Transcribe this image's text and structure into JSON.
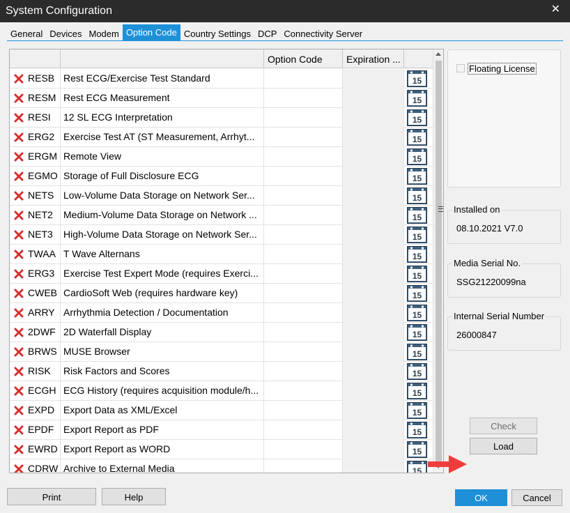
{
  "window": {
    "title": "System Configuration"
  },
  "tabs": [
    {
      "label": "General",
      "active": false
    },
    {
      "label": "Devices",
      "active": false
    },
    {
      "label": "Modem",
      "active": false
    },
    {
      "label": "Option Code",
      "active": true
    },
    {
      "label": "Country Settings",
      "active": false
    },
    {
      "label": "DCP",
      "active": false
    },
    {
      "label": "Connectivity Server",
      "active": false
    }
  ],
  "grid": {
    "headers": {
      "col1": "",
      "col2": "",
      "option_code": "Option Code",
      "expiration": "Expiration ...",
      "col5": ""
    },
    "calendar_label": "15",
    "rows": [
      {
        "code": "RESB",
        "description": "Rest ECG/Exercise Test Standard"
      },
      {
        "code": "RESM",
        "description": "Rest ECG Measurement"
      },
      {
        "code": "RESI",
        "description": "12 SL ECG Interpretation"
      },
      {
        "code": "ERG2",
        "description": "Exercise Test AT (ST Measurement, Arrhyt..."
      },
      {
        "code": "ERGM",
        "description": "Remote View"
      },
      {
        "code": "EGMO",
        "description": "Storage of Full Disclosure ECG"
      },
      {
        "code": "NETS",
        "description": "Low-Volume Data Storage on Network Ser..."
      },
      {
        "code": "NET2",
        "description": "Medium-Volume Data Storage on Network ..."
      },
      {
        "code": "NET3",
        "description": "High-Volume Data Storage on Network Ser..."
      },
      {
        "code": "TWAA",
        "description": "T Wave Alternans"
      },
      {
        "code": "ERG3",
        "description": "Exercise Test Expert Mode (requires Exerci..."
      },
      {
        "code": "CWEB",
        "description": "CardioSoft Web (requires hardware key)"
      },
      {
        "code": "ARRY",
        "description": "Arrhythmia Detection / Documentation"
      },
      {
        "code": "2DWF",
        "description": "2D Waterfall Display"
      },
      {
        "code": "BRWS",
        "description": "MUSE Browser"
      },
      {
        "code": "RISK",
        "description": "Risk Factors and Scores"
      },
      {
        "code": "ECGH",
        "description": "ECG History (requires acquisition module/h..."
      },
      {
        "code": "EXPD",
        "description": "Export Data as XML/Excel"
      },
      {
        "code": "EPDF",
        "description": "Export Report as PDF"
      },
      {
        "code": "EWRD",
        "description": "Export Report as WORD"
      },
      {
        "code": "CDRW",
        "description": "Archive to External Media"
      }
    ]
  },
  "license": {
    "floating_label": "Floating License",
    "floating_checked": false
  },
  "installed": {
    "label": "Installed on",
    "value": "08.10.2021  V7.0"
  },
  "media_serial": {
    "label": "Media Serial No.",
    "value": "SSG21220099na"
  },
  "internal_serial": {
    "label": "Internal Serial Number",
    "value": "26000847"
  },
  "buttons": {
    "check": "Check",
    "load": "Load",
    "print": "Print",
    "help": "Help",
    "ok": "OK",
    "cancel": "Cancel"
  },
  "colors": {
    "accent": "#1e90d8",
    "error_mark": "#d32f2f",
    "annotation_arrow": "#f03c3c"
  }
}
